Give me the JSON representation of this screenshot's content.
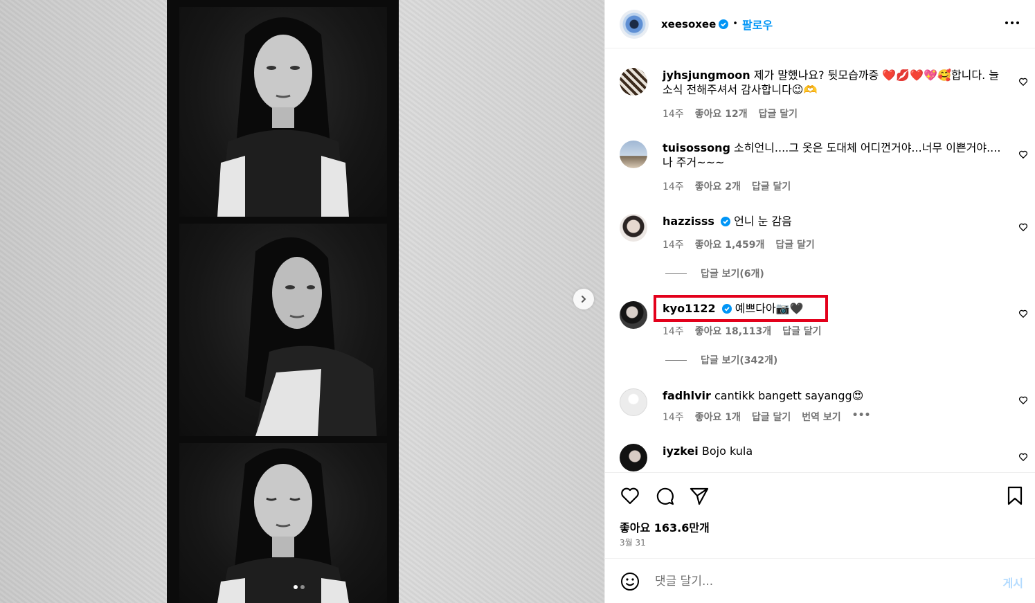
{
  "media": {
    "description_icon": "photo-carousel",
    "next_icon": "chevron-right-icon",
    "carousel_dots": 2,
    "active_dot": 0
  },
  "header": {
    "username": "xeesoxee",
    "verified": true,
    "separator": "•",
    "follow_label": "팔로우",
    "more_icon": "more-horizontal-icon"
  },
  "comments": [
    {
      "username": "jyhsjungmoon",
      "verified": false,
      "text": "제가 말했나요? 뒷모습까증 ❤️💋❤️💖🥰합니다. 늘 소식 전해주셔서 감사합니다😉🫶",
      "time": "14주",
      "likes": "좋아요 12개",
      "reply": "답글 달기"
    },
    {
      "username": "tuisossong",
      "verified": false,
      "text": "소히언니....그 옷은 도대체 어디껀거야...너무 이쁜거야....나 주거~~~",
      "time": "14주",
      "likes": "좋아요 2개",
      "reply": "답글 달기"
    },
    {
      "username": "hazzisss",
      "verified": true,
      "text": "언니 눈 감음",
      "time": "14주",
      "likes": "좋아요 1,459개",
      "reply": "답글 달기",
      "view_replies": "답글 보기(6개)"
    },
    {
      "username": "kyo1122",
      "verified": true,
      "text": "예쁘다아📷🖤",
      "time": "14주",
      "likes": "좋아요 18,113개",
      "reply": "답글 달기",
      "view_replies": "답글 보기(342개)"
    },
    {
      "username": "fadhlvir",
      "verified": false,
      "text": "cantikk bangett sayangg😍",
      "time": "14주",
      "likes": "좋아요 1개",
      "reply": "답글 달기",
      "translate": "번역 보기",
      "more": "•••"
    },
    {
      "username": "iyzkei",
      "verified": false,
      "text": "Bojo kula"
    }
  ],
  "highlight_color": "#e3001b",
  "actions": {
    "like_icon": "heart-icon",
    "comment_icon": "comment-icon",
    "share_icon": "send-icon",
    "save_icon": "bookmark-icon",
    "likes_text": "좋아요 163.6만개",
    "date": "3월 31"
  },
  "add_comment": {
    "emoji_icon": "smile-icon",
    "placeholder": "댓글 달기...",
    "post_label": "게시"
  },
  "colors": {
    "accent": "#0095f6",
    "muted": "#737373",
    "post_disabled": "#b3dbff"
  }
}
